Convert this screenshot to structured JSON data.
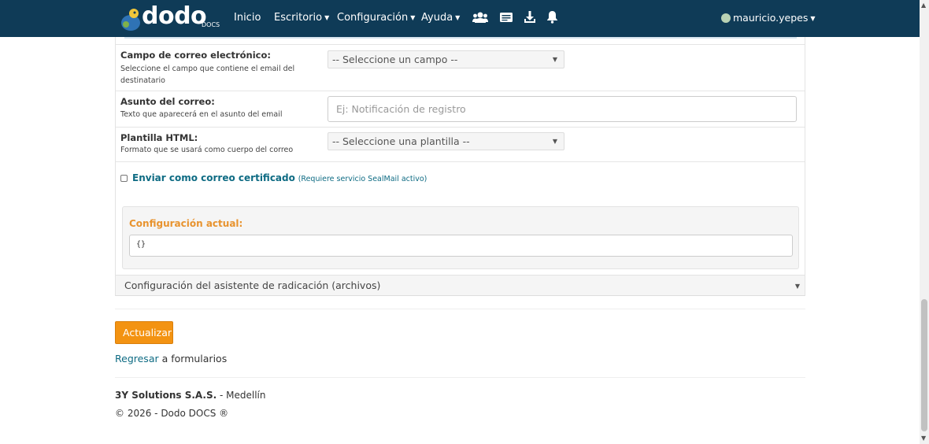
{
  "brand": {
    "logo_text": "dodo",
    "logo_sub": "DOCS"
  },
  "nav": {
    "inicio": "Inicio",
    "escritorio": "Escritorio",
    "configuracion": "Configuración",
    "ayuda": "Ayuda",
    "icons": [
      "users-icon",
      "messages-icon",
      "download-icon",
      "bell-icon"
    ],
    "user": "mauricio.yepes"
  },
  "form": {
    "email_field": {
      "label": "Campo de correo electrónico:",
      "help_1": "Seleccione el campo que contiene el email del",
      "help_2": "destinatario",
      "selected": "-- Seleccione un campo --"
    },
    "subject": {
      "label": "Asunto del correo:",
      "help": "Texto que aparecerá en el asunto del email",
      "placeholder": "Ej: Notificación de registro"
    },
    "template": {
      "label": "Plantilla HTML:",
      "help": "Formato que se usará como cuerpo del correo",
      "selected": "-- Seleccione una plantilla --"
    },
    "certified": {
      "label": "Enviar como correo certificado",
      "note": "(Requiere servicio SealMail activo)",
      "checked": false
    },
    "current_config": {
      "title": "Configuración actual:",
      "value": "{}"
    },
    "wizard_select": "Configuración del asistente de radicación (archivos)"
  },
  "actions": {
    "update": "Actualizar",
    "back_link": "Regresar",
    "back_rest": " a formularios"
  },
  "footer": {
    "company": "3Y Solutions S.A.S.",
    "city": " - Medellín",
    "copyright": "© 2026 - Dodo DOCS ®"
  },
  "colors": {
    "navbar": "#0f3b57",
    "accent": "#f39312",
    "link": "#0e6b83",
    "config_title": "#e8932e"
  }
}
